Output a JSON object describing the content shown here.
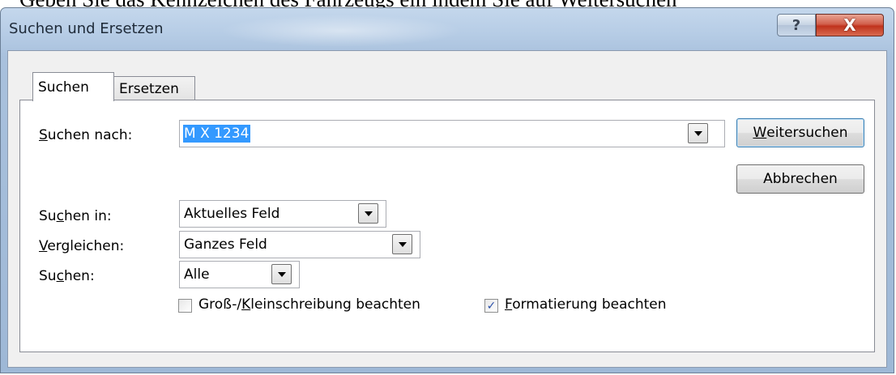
{
  "background_caption": "Geben Sie das Kennzeichen des Fahrzeugs ein indem Sie auf Weitersuchen",
  "window": {
    "title": "Suchen und Ersetzen",
    "help_glyph": "?",
    "close_glyph": "X"
  },
  "tabs": [
    {
      "label": "Suchen",
      "active": true
    },
    {
      "label": "Ersetzen",
      "active": false
    }
  ],
  "search_for": {
    "label_pre": "",
    "label_ul": "S",
    "label_post": "uchen nach:",
    "value": "M X 1234"
  },
  "search_in": {
    "label_pre": "Su",
    "label_ul": "c",
    "label_post": "hen in:",
    "value": "Aktuelles Feld"
  },
  "match": {
    "label_pre": "",
    "label_ul": "V",
    "label_post": "ergleichen:",
    "value": "Ganzes Feld"
  },
  "search_dir": {
    "label_pre": "Su",
    "label_ul": "c",
    "label_post": "hen:",
    "value": "Alle"
  },
  "buttons": {
    "find_next_ul": "W",
    "find_next_rest": "eitersuchen",
    "cancel": "Abbrechen"
  },
  "options": {
    "match_case_pre": "Groß-/",
    "match_case_ul": "K",
    "match_case_post": "leinschreibung beachten",
    "match_case_checked": false,
    "formatting_ul": "F",
    "formatting_post": "ormatierung beachten",
    "formatting_checked": true,
    "check_glyph": "✓"
  },
  "colors": {
    "selection": "#3399ff",
    "close_button": "#c7432c",
    "title_bar": "#b7cde6"
  }
}
